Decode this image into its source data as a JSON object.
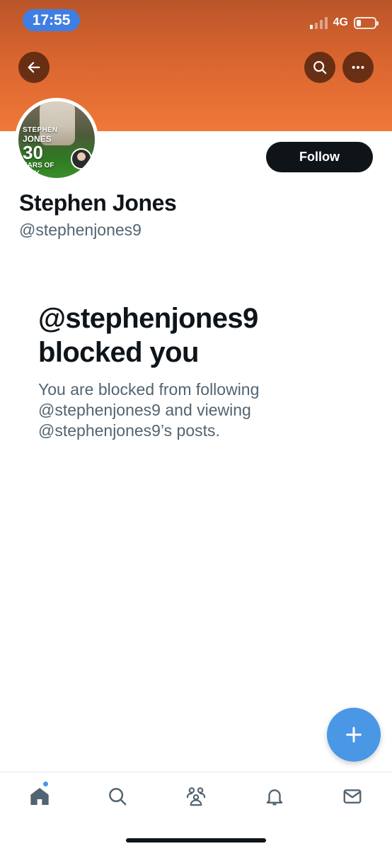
{
  "status_bar": {
    "time": "17:55",
    "network": "4G",
    "battery_level": 0.25
  },
  "header": {
    "back_icon": "arrow-left-icon",
    "search_icon": "search-icon",
    "more_icon": "more-horizontal-icon",
    "banner_color": "#e36a33"
  },
  "avatar": {
    "line1": "STEPHEN",
    "line2": "JONES",
    "line3": "30",
    "line4": "EARS OF",
    "line5": "GBY"
  },
  "profile": {
    "follow_label": "Follow",
    "name": "Stephen Jones",
    "handle": "@stephenjones9"
  },
  "blocked": {
    "title_line1": "@stephenjones9",
    "title_line2": "blocked you",
    "description_line1": "You are blocked from following",
    "description_line2": "@stephenjones9 and viewing",
    "description_line3": "@stephenjones9’s posts."
  },
  "fab": {
    "icon": "plus-icon",
    "color": "#4a97e6"
  },
  "bottom_nav": {
    "items": [
      {
        "icon": "home-icon",
        "active": true,
        "has_badge_dot": true
      },
      {
        "icon": "search-icon"
      },
      {
        "icon": "communities-icon"
      },
      {
        "icon": "bell-icon"
      },
      {
        "icon": "mail-icon"
      }
    ]
  }
}
